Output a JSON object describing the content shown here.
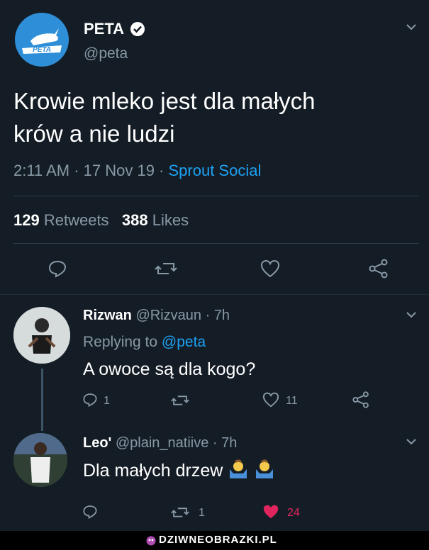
{
  "main_tweet": {
    "avatar_logo_text": "PETA",
    "name": "PETA",
    "handle": "@peta",
    "text_line1": "Krowie mleko jest dla małych",
    "text_line2": "krów a nie ludzi",
    "time": "2:11 AM · 17 Nov 19 · ",
    "source": "Sprout Social",
    "retweets_count": "129",
    "retweets_label": "Retweets",
    "likes_count": "388",
    "likes_label": "Likes"
  },
  "replies": [
    {
      "name": "Rizwan",
      "handle_time": "@Rizvaun · 7h",
      "replying_prefix": "Replying to ",
      "replying_handle": "@peta",
      "text": "A owoce są dla kogo?",
      "reply_count": "1",
      "retweet_count": "",
      "like_count": "11"
    },
    {
      "name": "Leo'",
      "handle_time": "@plain_natiive · 7h",
      "text": "Dla małych drzew",
      "reply_count": "",
      "retweet_count": "1",
      "like_count": "24"
    }
  ],
  "watermark": "DZIWNEOBRAZKI.PL",
  "colors": {
    "background": "#141d26",
    "accent": "#1da1f2",
    "muted": "#8899a6",
    "like_red": "#e0245e"
  }
}
